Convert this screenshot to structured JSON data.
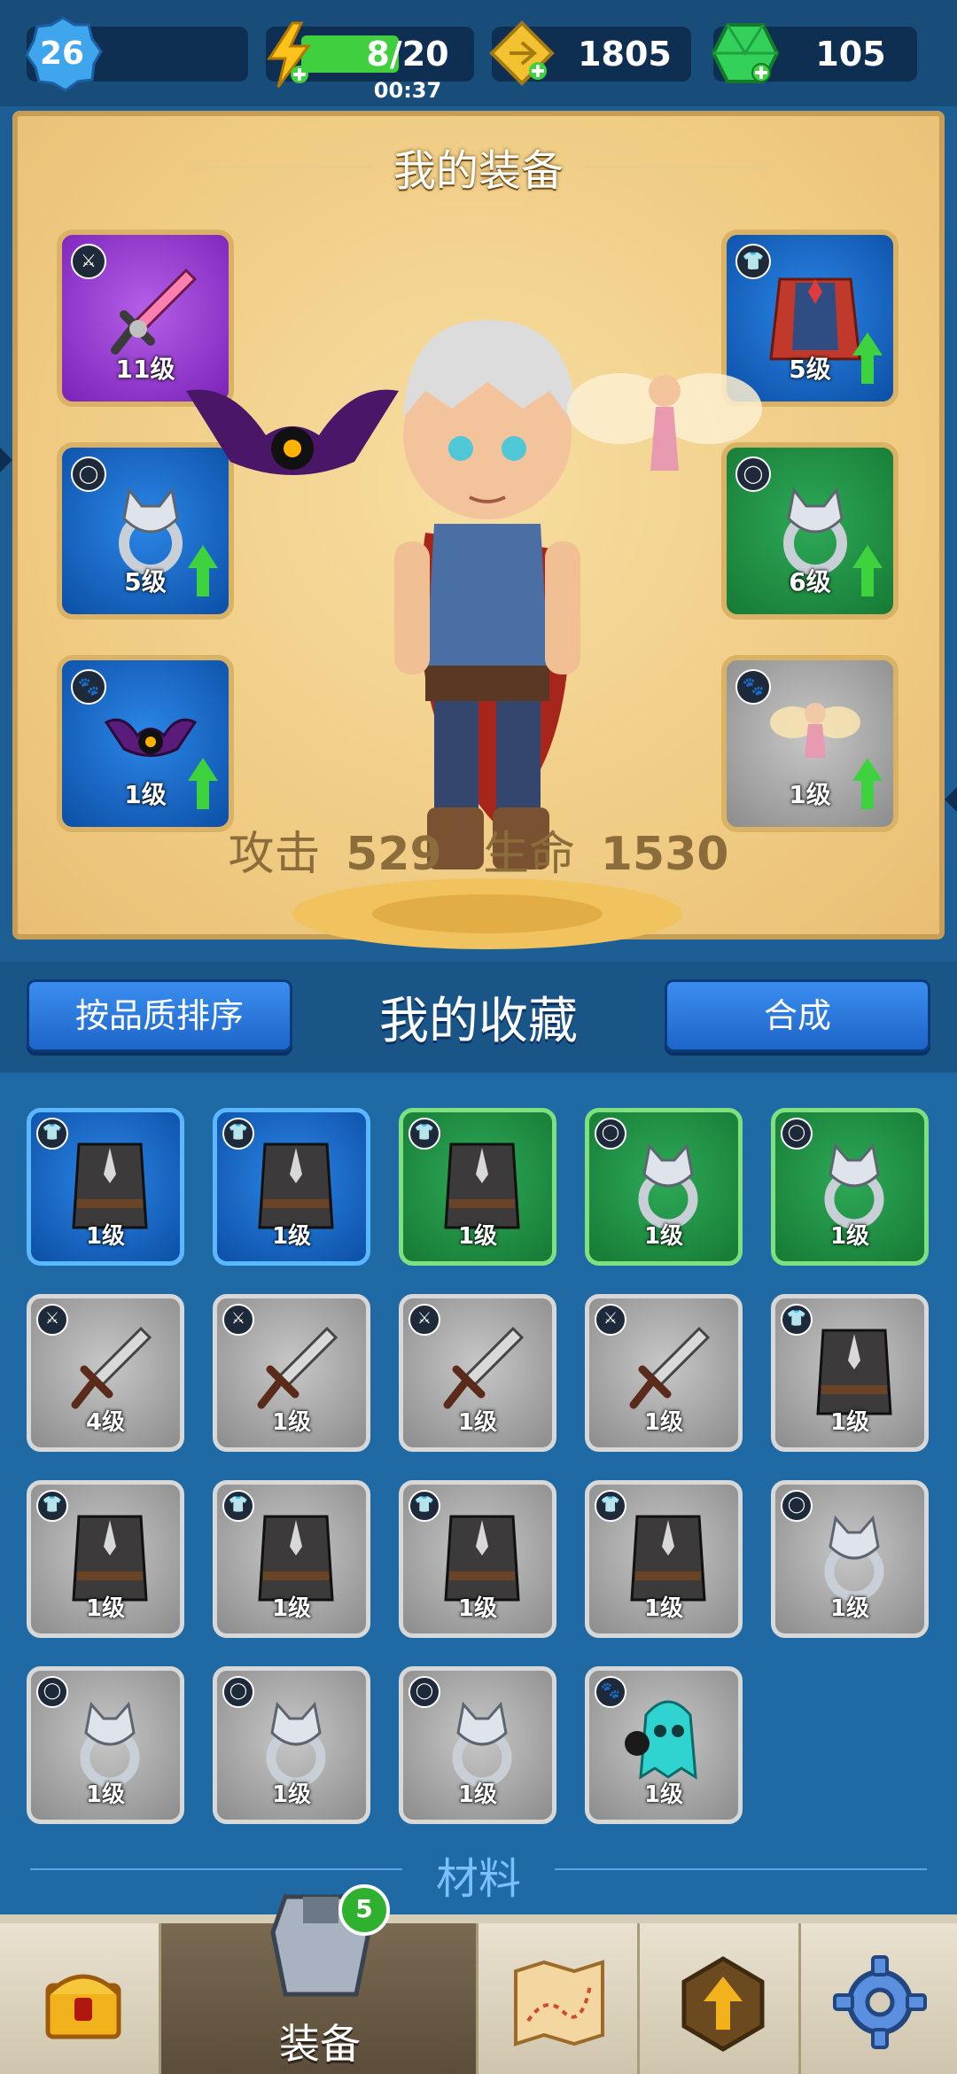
{
  "topbar": {
    "player_level": "26",
    "energy": "8/20",
    "energy_timer": "00:37",
    "gold": "1805",
    "gems": "105"
  },
  "equipment": {
    "title": "我的装备",
    "slots": [
      {
        "category": "weapon-icon",
        "level": "11级",
        "quality": "#9b3fd6",
        "upgrade": false
      },
      {
        "category": "armor-icon",
        "level": "5级",
        "quality": "#1a6fd0",
        "upgrade": true
      },
      {
        "category": "ring-icon",
        "level": "5级",
        "quality": "#1a6fd0",
        "upgrade": true
      },
      {
        "category": "ring-icon",
        "level": "6级",
        "quality": "#1f9444",
        "upgrade": true
      },
      {
        "category": "pet-icon",
        "level": "1级",
        "quality": "#1a6fd0",
        "upgrade": true
      },
      {
        "category": "pet-icon",
        "level": "1级",
        "quality": "#a0a0a0",
        "upgrade": true
      }
    ],
    "attack_label": "攻击",
    "attack_value": "529",
    "hp_label": "生命",
    "hp_value": "1530"
  },
  "collection": {
    "sort_button": "按品质排序",
    "title": "我的收藏",
    "merge_button": "合成",
    "items": [
      {
        "category": "armor-icon",
        "level": "1级",
        "quality": "blue"
      },
      {
        "category": "armor-icon",
        "level": "1级",
        "quality": "blue"
      },
      {
        "category": "armor-icon",
        "level": "1级",
        "quality": "green"
      },
      {
        "category": "ring-icon",
        "level": "1级",
        "quality": "green"
      },
      {
        "category": "ring-icon",
        "level": "1级",
        "quality": "green"
      },
      {
        "category": "weapon-icon",
        "level": "4级",
        "quality": "grey"
      },
      {
        "category": "weapon-icon",
        "level": "1级",
        "quality": "grey"
      },
      {
        "category": "weapon-icon",
        "level": "1级",
        "quality": "grey"
      },
      {
        "category": "weapon-icon",
        "level": "1级",
        "quality": "grey"
      },
      {
        "category": "armor-icon",
        "level": "1级",
        "quality": "grey"
      },
      {
        "category": "armor-icon",
        "level": "1级",
        "quality": "grey"
      },
      {
        "category": "armor-icon",
        "level": "1级",
        "quality": "grey"
      },
      {
        "category": "armor-icon",
        "level": "1级",
        "quality": "grey"
      },
      {
        "category": "armor-icon",
        "level": "1级",
        "quality": "grey"
      },
      {
        "category": "ring-icon",
        "level": "1级",
        "quality": "grey"
      },
      {
        "category": "ring-icon",
        "level": "1级",
        "quality": "grey"
      },
      {
        "category": "ring-icon",
        "level": "1级",
        "quality": "grey"
      },
      {
        "category": "ring-icon",
        "level": "1级",
        "quality": "grey"
      },
      {
        "category": "pet-icon",
        "level": "1级",
        "quality": "grey"
      }
    ],
    "materials_label": "材料"
  },
  "nav": {
    "equip_label": "装备",
    "equip_badge": "5"
  },
  "colors": {
    "purple": "#9b3fd6",
    "blue": "#1a6fd0",
    "green": "#1f9444",
    "grey": "#a0a0a0",
    "upgrade_arrow": "#3ed33e"
  }
}
